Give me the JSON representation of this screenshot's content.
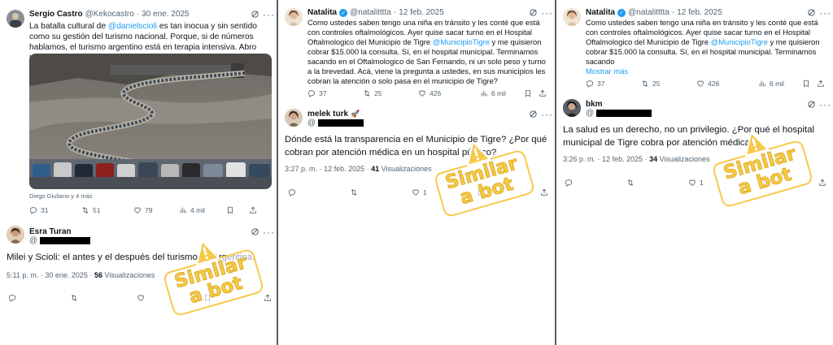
{
  "panels": [
    {
      "main_tweet": {
        "name": "Sergio Castro",
        "handle": "@Kekocastro",
        "sep": "·",
        "date": "30 ene. 2025",
        "text_parts": [
          "La batalla cultural de ",
          "@danielscioli",
          " es tan inocua y sin sentido como su gestión del turismo nacional. Porque, si de números hablamos, el turismo argentino está en terapia intensiva. Abro hilo👇"
        ],
        "caption": "Diego Giuliano y 4 más",
        "actions": {
          "reply": "31",
          "retweet": "51",
          "like": "79",
          "views": "4 mil"
        }
      },
      "reply": {
        "name": "Esra Turan",
        "handle_prefix": "@",
        "text": "Milei y Scioli: el antes y el después del turismo en Argentina.",
        "time": "5:11 p. m.",
        "sep": "·",
        "date": "30 ene. 2025",
        "sep2": "·",
        "views_count": "56",
        "views_label": "Visualizaciones"
      },
      "stamp": {
        "line1": "Similar",
        "line2": "a bot"
      }
    },
    {
      "main_tweet": {
        "name": "Natalita",
        "handle": "@natalitttta",
        "sep": "·",
        "date": "12 feb. 2025",
        "text_parts": [
          "Como ustedes saben tengo una niña en tránsito y les conté que está con controles oftalmológicos. Ayer quise sacar turno en el Hospital Oftalmologico del Municipio de Tigre ",
          "@MunicipioTigre",
          " y me quisieron cobrar $15.000 la consulta. Sí, en el hospital municipal. Terminamos sacando en el Oftalmologico de San Fernando, ni un solo peso y turno a la brevedad. Acá, viene la pregunta a ustedes, en sus municipios les cobran la atención o solo pasa en el municipio de Tigre?"
        ],
        "actions": {
          "reply": "37",
          "retweet": "25",
          "like": "426",
          "views": "6 mil"
        }
      },
      "reply": {
        "name": "melek turk",
        "name_emoji": "🚀",
        "handle_prefix": "@",
        "text": "Dónde está la transparencia en el Municipio de Tigre? ¿Por qué cobran por atención médica en un hospital público?",
        "time": "3:27 p. m.",
        "sep": "·",
        "date": "12 feb. 2025",
        "sep2": "·",
        "views_count": "41",
        "views_label": "Visualizaciones",
        "like_count": "1"
      },
      "stamp": {
        "line1": "Similar",
        "line2": "a bot"
      }
    },
    {
      "main_tweet": {
        "name": "Natalita",
        "handle": "@natalitttta",
        "sep": "·",
        "date": "12 feb. 2025",
        "text_parts": [
          "Como ustedes saben tengo una niña en tránsito y les conté que está con controles oftalmológicos. Ayer quise sacar turno en el Hospital Oftalmologico del Municipio de Tigre ",
          "@MunicipioTigre",
          " y me quisieron cobrar $15.000 la consulta. Sí, en el hospital municipal. Terminamos sacando"
        ],
        "show_more": "Mostrar más",
        "actions": {
          "reply": "37",
          "retweet": "25",
          "like": "426",
          "views": "6 mil"
        }
      },
      "reply": {
        "name": "bkm",
        "handle_prefix": "@",
        "text": "La salud es un derecho, no un privilegio. ¿Por qué el hospital municipal de Tigre cobra por atención médica?",
        "time": "3:26 p. m.",
        "sep": "·",
        "date": "12 feb. 2025",
        "sep2": "·",
        "views_count": "34",
        "views_label": "Visualizaciones",
        "like_count": "1"
      },
      "stamp": {
        "line1": "Similar",
        "line2": "a bot"
      }
    }
  ],
  "colors": {
    "accent": "#1d9bf0",
    "muted": "#536471",
    "stamp": "#f7c948",
    "separator": "#5c5c5c"
  }
}
